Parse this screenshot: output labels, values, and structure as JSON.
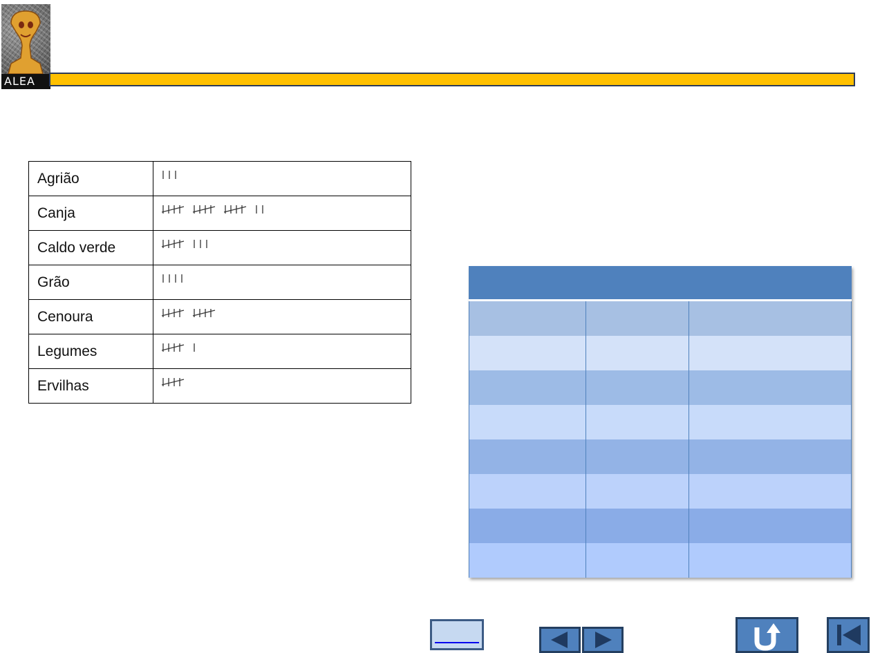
{
  "header": {
    "logo_text": "ALEA",
    "bar_color": "#ffc000"
  },
  "tally_table": {
    "rows": [
      {
        "label": "Agrião",
        "count": 3
      },
      {
        "label": "Canja",
        "count": 17
      },
      {
        "label": "Caldo verde",
        "count": 8
      },
      {
        "label": "Grão",
        "count": 4
      },
      {
        "label": "Cenoura",
        "count": 10
      },
      {
        "label": "Legumes",
        "count": 6
      },
      {
        "label": "Ervilhas",
        "count": 5
      }
    ]
  },
  "blue_table": {
    "header_color": "#4f81bd",
    "row_colors": [
      "#a7c0e3",
      "#d4e2f9",
      "#9dbbe6",
      "#c8dbfa",
      "#93b3e6",
      "#bcd2fb",
      "#8aace7",
      "#b0cbfd"
    ]
  },
  "navigation": {
    "link_button_color": "#c6d9f1",
    "button_color": "#4f81bd",
    "icons": [
      "link-icon",
      "previous-arrow-icon",
      "next-arrow-icon",
      "return-icon",
      "first-slide-icon"
    ]
  }
}
